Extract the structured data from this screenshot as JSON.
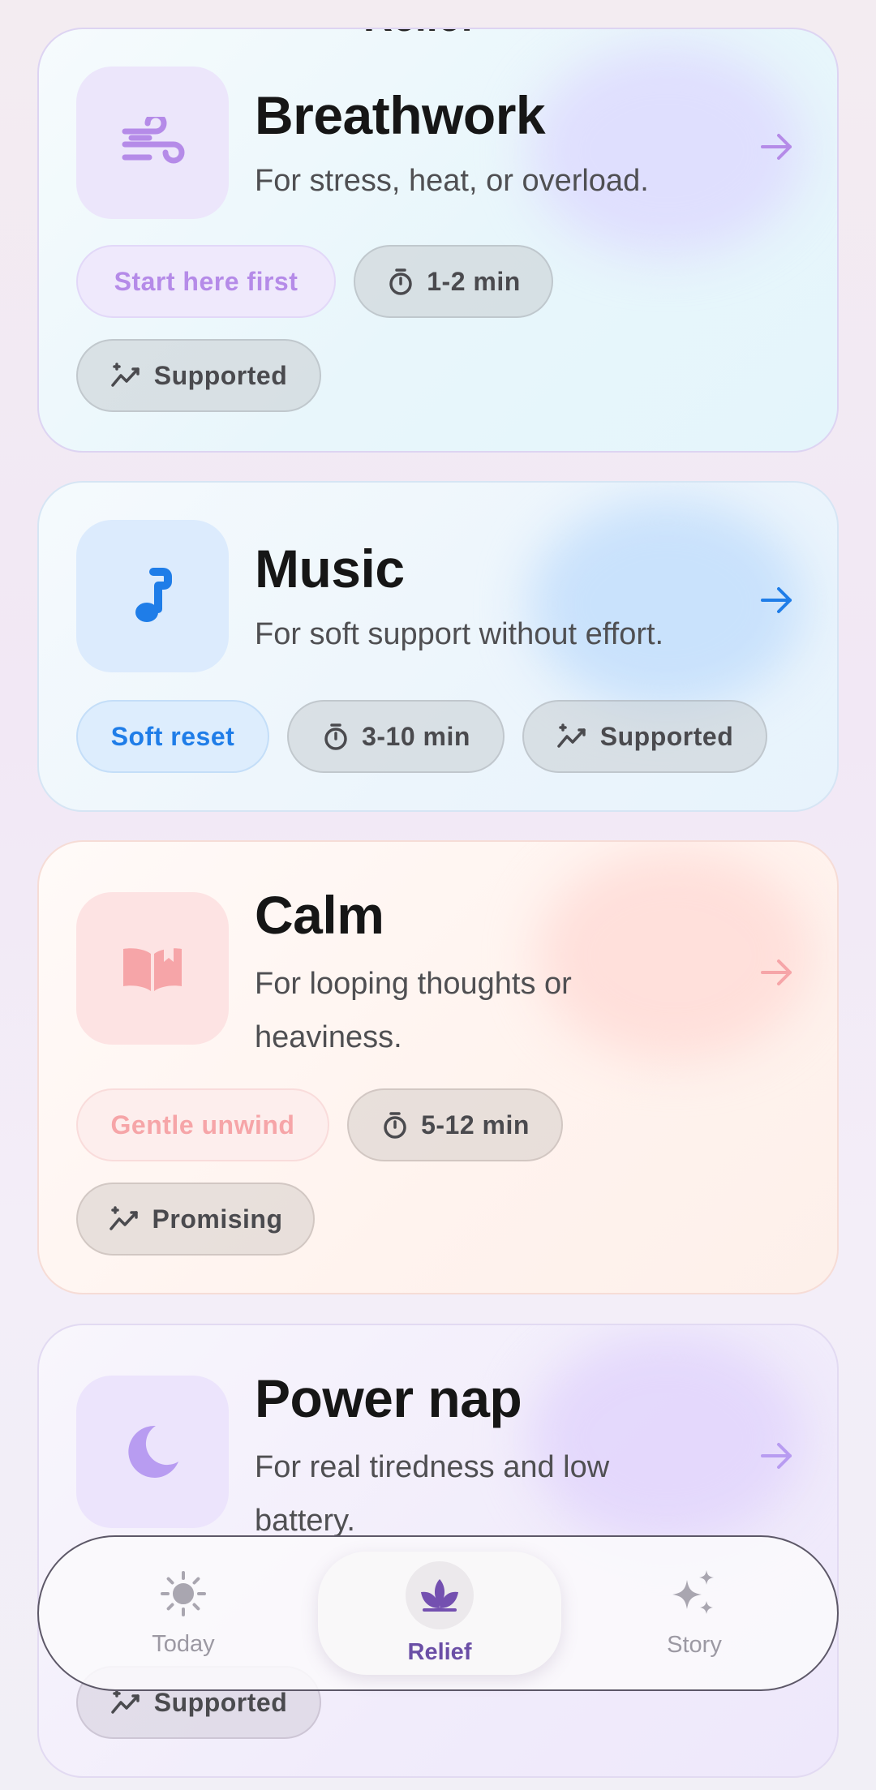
{
  "header": {
    "clipped_title": "Relief"
  },
  "cards": [
    {
      "title": "Breathwork",
      "description": "For stress, heat, or overload.",
      "icon": "wind-icon",
      "chips": {
        "tag": "Start here first",
        "duration": "1-2 min",
        "evidence": "Supported"
      },
      "colors": {
        "accent": "#b58be8",
        "tile": "#ece6fb"
      }
    },
    {
      "title": "Music",
      "description": "For soft support without effort.",
      "icon": "music-note-icon",
      "chips": {
        "tag": "Soft reset",
        "duration": "3-10 min",
        "evidence": "Supported"
      },
      "colors": {
        "accent": "#1f7de8",
        "tile": "#dcebfd"
      }
    },
    {
      "title": "Calm",
      "description": "For looping thoughts or heaviness.",
      "icon": "book-icon",
      "chips": {
        "tag": "Gentle unwind",
        "duration": "5-12 min",
        "evidence": "Promising"
      },
      "colors": {
        "accent": "#f6a5a8",
        "tile": "#fde3e3"
      }
    },
    {
      "title": "Power nap",
      "description": "For real tiredness and low battery.",
      "icon": "moon-icon",
      "chips": {
        "evidence": "Supported"
      },
      "colors": {
        "accent": "#b89cf1",
        "tile": "#ece4fc"
      }
    }
  ],
  "nav": {
    "items": [
      {
        "label": "Today",
        "icon": "sun-icon",
        "active": false
      },
      {
        "label": "Relief",
        "icon": "lotus-icon",
        "active": true
      },
      {
        "label": "Story",
        "icon": "sparkles-icon",
        "active": false
      }
    ]
  }
}
